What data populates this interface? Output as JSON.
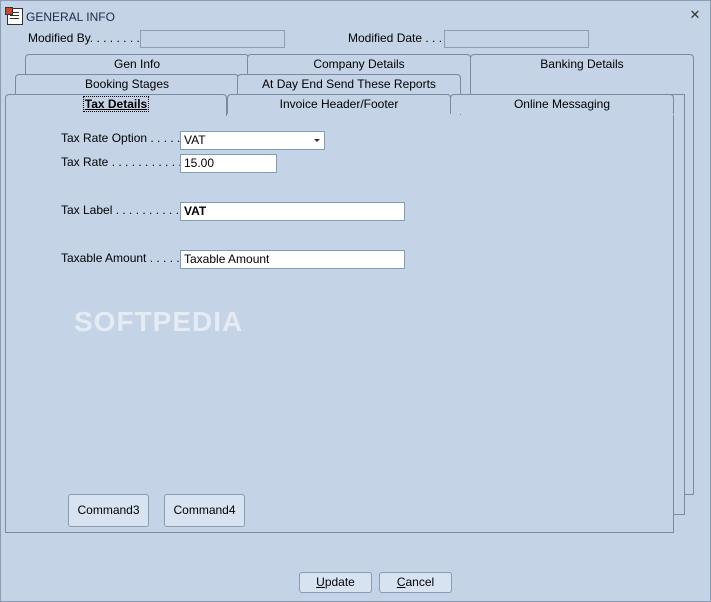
{
  "window": {
    "title": "GENERAL INFO",
    "close_glyph": "✕"
  },
  "header": {
    "modified_by_label": "Modified By. . . . . . . . . .",
    "modified_by_value": "",
    "modified_date_label": "Modified Date  . . . .",
    "modified_date_value": ""
  },
  "tabs": {
    "row1": [
      "Gen Info",
      "Company Details",
      "Banking Details"
    ],
    "row2": [
      "Booking Stages",
      "At Day End Send These Reports"
    ],
    "row3": [
      "Tax Details",
      "Invoice Header/Footer",
      "Online Messaging"
    ],
    "active": "Tax Details"
  },
  "form": {
    "tax_rate_option_label": "Tax Rate Option . . . . . . .",
    "tax_rate_option_value": "VAT",
    "tax_rate_label": "Tax Rate . . . . . . . . . . . .",
    "tax_rate_value": "15.00",
    "tax_label_label": "Tax Label . . . . . . . . . . . .",
    "tax_label_value": "VAT",
    "taxable_amount_label": "Taxable Amount . . . . . . .",
    "taxable_amount_value": "Taxable Amount"
  },
  "buttons": {
    "command3": "Command3",
    "command4": "Command4",
    "update_first": "U",
    "update_rest": "pdate",
    "cancel_first": "C",
    "cancel_rest": "ancel"
  },
  "watermark": "SOFTPEDIA",
  "icons": {
    "app": "document-icon",
    "close": "close-icon",
    "dropdown": "chevron-down-icon"
  }
}
